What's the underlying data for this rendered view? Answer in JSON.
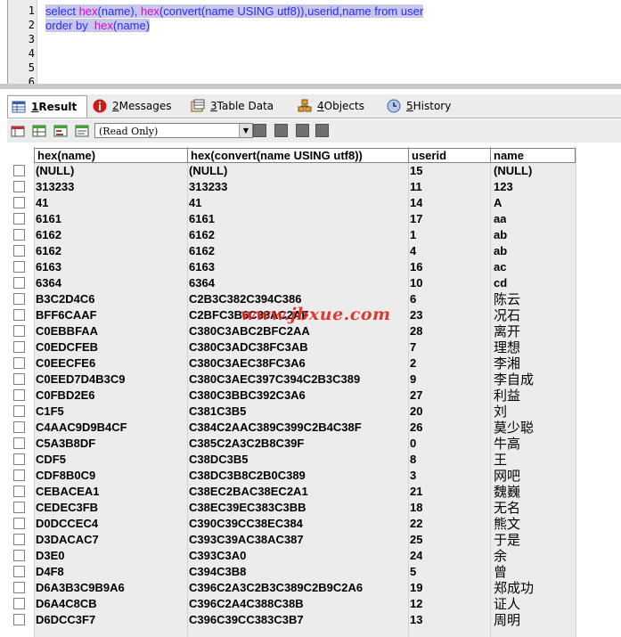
{
  "editor": {
    "line_numbers": [
      "1",
      "2",
      "3",
      "4",
      "5",
      "6"
    ],
    "line1": {
      "t1": "select ",
      "t2": "hex",
      "t3": "(name), ",
      "t4": "hex",
      "t5": "(",
      "t6": "convert",
      "t7": "(name USING utf8)),userid,name from user"
    },
    "line2": {
      "t1": "order by  ",
      "t2": "hex",
      "t3": "(name)"
    }
  },
  "tabs": [
    {
      "num": "1",
      "label": " Result",
      "icon": "result-grid-icon"
    },
    {
      "num": "2",
      "label": " Messages",
      "icon": "info-icon"
    },
    {
      "num": "3",
      "label": " Table Data",
      "icon": "table-data-icon"
    },
    {
      "num": "4",
      "label": " Objects",
      "icon": "objects-icon"
    },
    {
      "num": "5",
      "label": " History",
      "icon": "history-icon"
    }
  ],
  "toolbar": {
    "mode_value": "(Read Only)"
  },
  "grid": {
    "columns": [
      "hex(name)",
      "hex(convert(name USING utf8))",
      "userid",
      "name"
    ],
    "rows": [
      [
        "(NULL)",
        "(NULL)",
        "15",
        "(NULL)"
      ],
      [
        "313233",
        "313233",
        "11",
        "123"
      ],
      [
        "41",
        "41",
        "14",
        "A"
      ],
      [
        "6161",
        "6161",
        "17",
        "aa"
      ],
      [
        "6162",
        "6162",
        "1",
        "ab"
      ],
      [
        "6162",
        "6162",
        "4",
        "ab"
      ],
      [
        "6163",
        "6163",
        "16",
        "ac"
      ],
      [
        "6364",
        "6364",
        "10",
        "cd"
      ],
      [
        "B3C2D4C6",
        "C2B3C382C394C386",
        "6",
        "陈云"
      ],
      [
        "BFF6CAAF",
        "C2BFC3B6C38AC2AF",
        "23",
        "况石"
      ],
      [
        "C0EBBFAA",
        "C380C3ABC2BFC2AA",
        "28",
        "离开"
      ],
      [
        "C0EDCFEB",
        "C380C3ADC38FC3AB",
        "7",
        "理想"
      ],
      [
        "C0EECFE6",
        "C380C3AEC38FC3A6",
        "2",
        "李湘"
      ],
      [
        "C0EED7D4B3C9",
        "C380C3AEC397C394C2B3C389",
        "9",
        "李自成"
      ],
      [
        "C0FBD2E6",
        "C380C3BBC392C3A6",
        "27",
        "利益"
      ],
      [
        "C1F5",
        "C381C3B5",
        "20",
        "刘"
      ],
      [
        "C4AAC9D9B4CF",
        "C384C2AAC389C399C2B4C38F",
        "26",
        "莫少聪"
      ],
      [
        "C5A3B8DF",
        "C385C2A3C2B8C39F",
        "0",
        "牛高"
      ],
      [
        "CDF5",
        "C38DC3B5",
        "8",
        "王"
      ],
      [
        "CDF8B0C9",
        "C38DC3B8C2B0C389",
        "3",
        "网吧"
      ],
      [
        "CEBACEA1",
        "C38EC2BAC38EC2A1",
        "21",
        "魏巍"
      ],
      [
        "CEDEC3FB",
        "C38EC39EC383C3BB",
        "18",
        "无名"
      ],
      [
        "D0DCCEC4",
        "C390C39CC38EC384",
        "22",
        "熊文"
      ],
      [
        "D3DACAC7",
        "C393C39AC38AC387",
        "25",
        "于是"
      ],
      [
        "D3E0",
        "C393C3A0",
        "24",
        "余"
      ],
      [
        "D4F8",
        "C394C3B8",
        "5",
        "曾"
      ],
      [
        "D6A3B3C9B9A6",
        "C396C2A3C2B3C389C2B9C2A6",
        "19",
        "郑成功"
      ],
      [
        "D6A4C8CB",
        "C396C2A4C388C38B",
        "12",
        "证人"
      ],
      [
        "D6DCC3F7",
        "C396C39CC383C3B7",
        "13",
        "周明"
      ]
    ]
  },
  "watermark": "www.jbxue.com"
}
